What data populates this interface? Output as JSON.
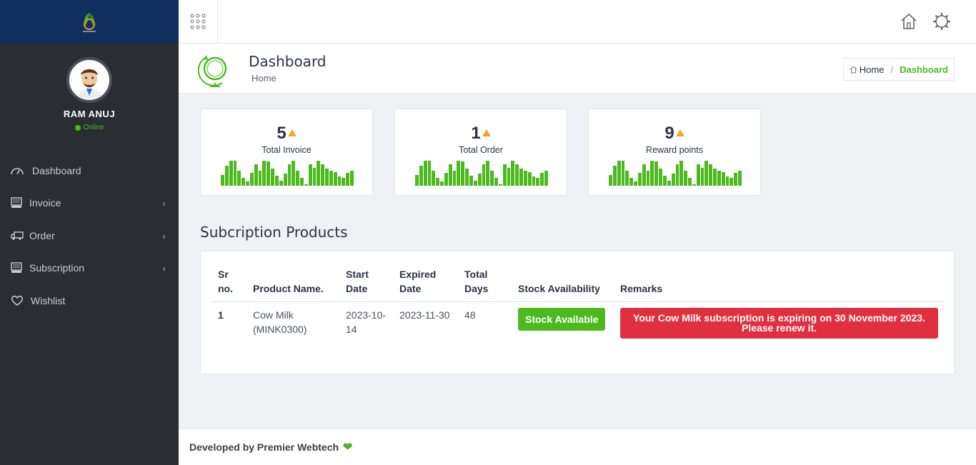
{
  "brand": {
    "logo_icon": "leaf-logo-icon"
  },
  "user": {
    "name": "RAM ANUJ",
    "status": "Online"
  },
  "sidebar": {
    "items": [
      {
        "label": "Dashboard",
        "icon": "dashboard-icon",
        "has_children": false
      },
      {
        "label": "Invoice",
        "icon": "invoice-icon",
        "has_children": true
      },
      {
        "label": "Order",
        "icon": "truck-icon",
        "has_children": true
      },
      {
        "label": "Subscription",
        "icon": "subscription-icon",
        "has_children": true
      },
      {
        "label": "Wishlist",
        "icon": "heart-icon",
        "has_children": false
      }
    ]
  },
  "topbar": {
    "icons": [
      "apps-grid-icon",
      "home-icon",
      "settings-gear-icon"
    ]
  },
  "page_header": {
    "title": "Dashboard",
    "subtitle": "Home"
  },
  "breadcrumb": {
    "home": "Home",
    "current": "Dashboard"
  },
  "stats": [
    {
      "value": "5",
      "label": "Total Invoice"
    },
    {
      "value": "1",
      "label": "Total Order"
    },
    {
      "value": "9",
      "label": "Reward points"
    }
  ],
  "subscription": {
    "title": "Subcription Products",
    "columns": {
      "sr": "Sr no.",
      "product": "Product Name.",
      "start": "Start Date",
      "expired": "Expired Date",
      "total": "Total Days",
      "stock": "Stock Availability",
      "remarks": "Remarks"
    },
    "rows": [
      {
        "sr": "1",
        "product": "Cow Milk (MINK0300)",
        "start": "2023-10-14",
        "expired": "2023-11-30",
        "total": "48",
        "stock": "Stock Available",
        "remarks_line1": "Your Cow Milk subscription is expiring on 30 November 2023.",
        "remarks_line2": "Please renew it."
      }
    ]
  },
  "footer": {
    "text": "Developed by Premier Webtech"
  },
  "colors": {
    "accent": "#4cba1f",
    "sidebar": "#2a2e33",
    "brand_bar": "#0f2f5e",
    "alert": "#e0303f",
    "trend": "#f5a623"
  }
}
